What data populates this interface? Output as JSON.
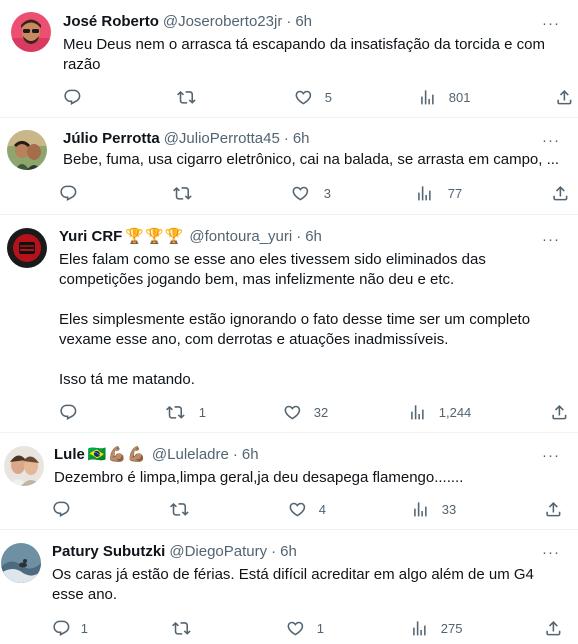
{
  "tweets": [
    {
      "name": "José Roberto",
      "handle": "@Joseroberto23jr",
      "time": "6h",
      "lines": [
        "Meu Deus nem o arrasca tá escapando da insatisfação da torcida e com",
        "razão"
      ],
      "replies": "",
      "retweets": "",
      "likes": "5",
      "views": "801"
    },
    {
      "name": "Júlio Perrotta",
      "handle": "@JulioPerrotta45",
      "time": "6h",
      "lines": [
        "Bebe, fuma, usa cigarro eletrônico, cai na balada, se arrasta em campo, ..."
      ],
      "replies": "",
      "retweets": "",
      "likes": "3",
      "views": "77"
    },
    {
      "name": "Yuri CRF",
      "badges": [
        "🏆",
        "🏆",
        "🏆"
      ],
      "handle": "@fontoura_yuri",
      "time": "6h",
      "paragraph1": [
        "Eles falam como se esse ano eles tivessem sido eliminados das",
        "competições jogando bem, mas infelizmente não deu e etc."
      ],
      "paragraph2": [
        "Eles simplesmente estão ignorando o fato desse time ser um completo",
        "vexame esse ano, com derrotas e atuações inadmissíveis."
      ],
      "paragraph3": [
        "Isso tá me matando."
      ],
      "replies": "",
      "retweets": "1",
      "likes": "32",
      "views": "1,244"
    },
    {
      "name": "Lule",
      "badges": [
        "🇧🇷",
        "💪🏽",
        "💪🏽"
      ],
      "handle": "@Luleladre",
      "time": "6h",
      "lines": [
        "Dezembro é limpa,limpa geral,ja deu desapega flamengo......."
      ],
      "replies": "",
      "retweets": "",
      "likes": "4",
      "views": "33"
    },
    {
      "name": "Patury Subutzki",
      "handle": "@DiegoPatury",
      "time": "6h",
      "lines": [
        "Os caras já estão de férias. Está difícil acreditar em algo além de um G4",
        "esse ano."
      ],
      "replies": "1",
      "retweets": "",
      "likes": "1",
      "views": "275"
    }
  ],
  "colors": {
    "text": "#0f1419",
    "secondary": "#536471",
    "divider": "#eff3f4"
  },
  "icons": [
    "reply-icon",
    "retweet-icon",
    "like-icon",
    "views-icon",
    "share-icon",
    "more-icon"
  ]
}
